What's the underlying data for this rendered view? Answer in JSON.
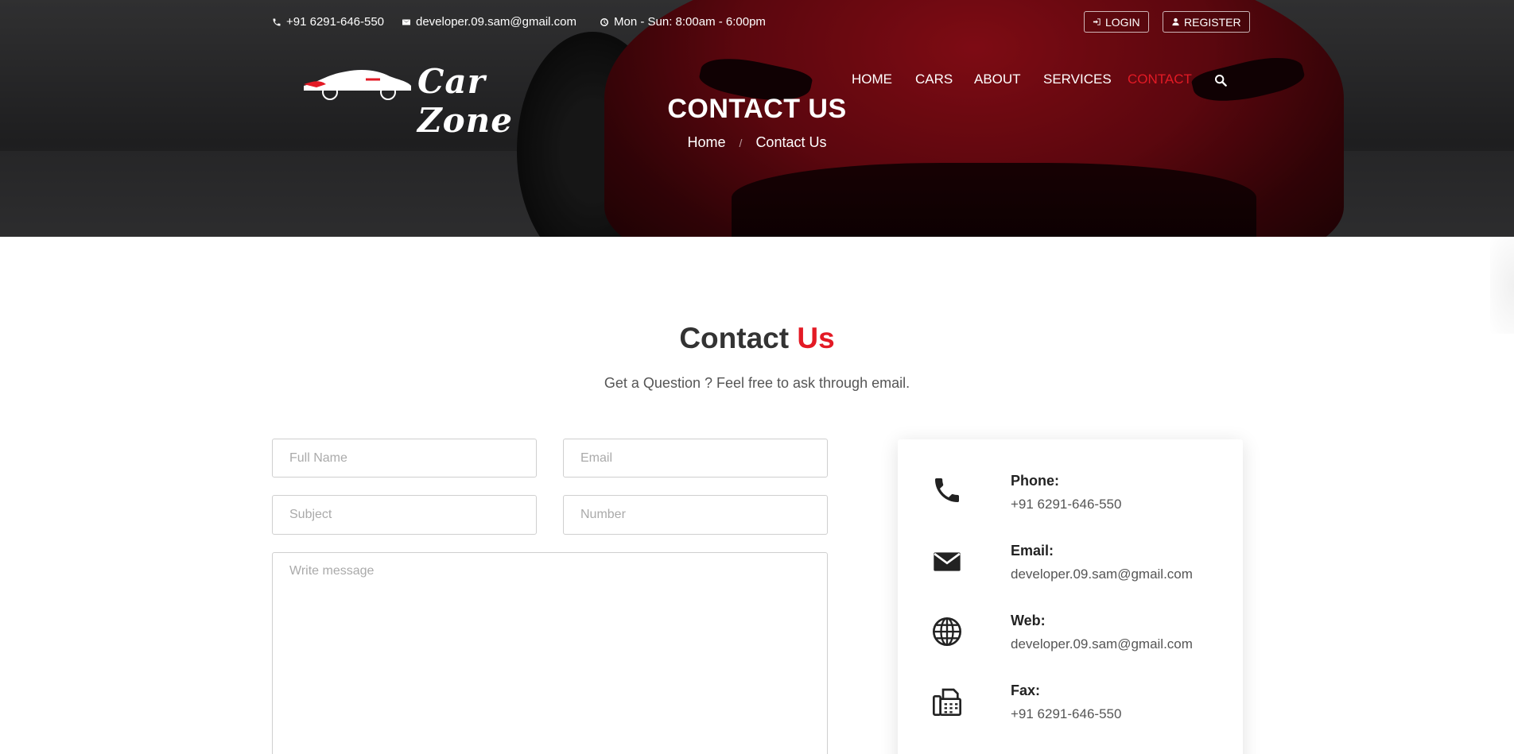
{
  "topbar": {
    "phone": "+91 6291-646-550",
    "email": "developer.09.sam@gmail.com",
    "hours": "Mon - Sun: 8:00am - 6:00pm",
    "login_label": "LOGIN",
    "register_label": "REGISTER"
  },
  "brand": {
    "name": "Car Zone"
  },
  "nav": {
    "items": [
      {
        "label": "HOME"
      },
      {
        "label": "CARS"
      },
      {
        "label": "ABOUT"
      },
      {
        "label": "SERVICES"
      },
      {
        "label": "CONTACT",
        "active": true
      }
    ]
  },
  "hero": {
    "title": "CONTACT US",
    "breadcrumb_home": "Home",
    "breadcrumb_separator": "/",
    "breadcrumb_current": "Contact Us"
  },
  "section": {
    "title_main": "Contact",
    "title_accent": "Us",
    "subtitle": "Get a Question ? Feel free to ask through email."
  },
  "form": {
    "full_name_placeholder": "Full Name",
    "email_placeholder": "Email",
    "subject_placeholder": "Subject",
    "number_placeholder": "Number",
    "message_placeholder": "Write message"
  },
  "contact_info": [
    {
      "label": "Phone:",
      "value": "+91 6291-646-550",
      "icon": "phone-icon"
    },
    {
      "label": "Email:",
      "value": "developer.09.sam@gmail.com",
      "icon": "envelope-icon"
    },
    {
      "label": "Web:",
      "value": "developer.09.sam@gmail.com",
      "icon": "globe-icon"
    },
    {
      "label": "Fax:",
      "value": "+91 6291-646-550",
      "icon": "fax-icon"
    }
  ],
  "colors": {
    "accent": "#e31a25",
    "text": "#333333"
  }
}
